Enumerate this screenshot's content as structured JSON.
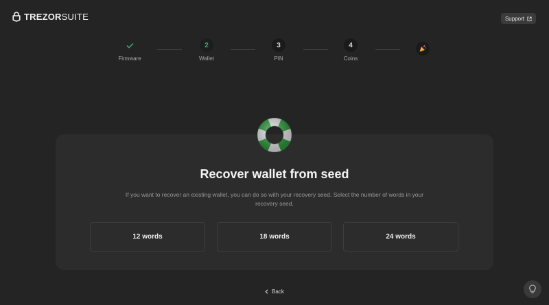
{
  "header": {
    "logo_bold": "TREZOR",
    "logo_light": "SUITE",
    "support_label": "Support"
  },
  "steps": [
    {
      "number": "",
      "label": "Firmware",
      "state": "done"
    },
    {
      "number": "2",
      "label": "Wallet",
      "state": "active"
    },
    {
      "number": "3",
      "label": "PIN",
      "state": "pending"
    },
    {
      "number": "4",
      "label": "Coins",
      "state": "pending"
    },
    {
      "number": "",
      "label": "",
      "state": "final"
    }
  ],
  "card": {
    "title": "Recover wallet from seed",
    "description": "If you want to recover an existing wallet, you can do so with your recovery seed. Select the number of words in your recovery seed.",
    "options": [
      "12 words",
      "18 words",
      "24 words"
    ]
  },
  "footer": {
    "back_label": "Back"
  },
  "colors": {
    "background": "#242424",
    "card": "#2c2c2c",
    "accent_green": "#3fae6a"
  },
  "icons": {
    "logo": "trezor-lock-icon",
    "support": "external-link-icon",
    "done_step": "check-icon",
    "final_step": "party-popper-icon",
    "hero": "lifebuoy-icon",
    "back": "chevron-left-icon",
    "tips": "lightbulb-icon"
  }
}
